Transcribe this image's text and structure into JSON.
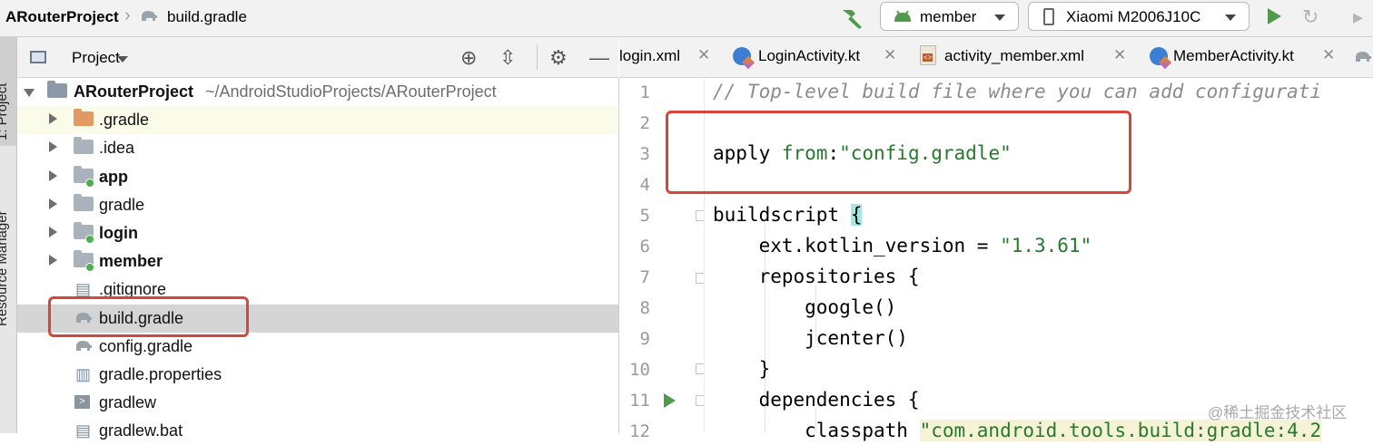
{
  "breadcrumb": {
    "project": "ARouterProject",
    "file": "build.gradle"
  },
  "toolbar": {
    "run_config": "member",
    "device": "Xiaomi M2006J10C"
  },
  "side_strip": {
    "tab_project": "1: Project",
    "tab_resource": "Resource Manager"
  },
  "project_panel": {
    "title": "Project",
    "root_name": "ARouterProject",
    "root_path": "~/AndroidStudioProjects/ARouterProject",
    "items": [
      {
        "label": ".gradle"
      },
      {
        "label": ".idea"
      },
      {
        "label": "app"
      },
      {
        "label": "gradle"
      },
      {
        "label": "login"
      },
      {
        "label": "member"
      },
      {
        "label": ".gitignore"
      },
      {
        "label": "build.gradle"
      },
      {
        "label": "config.gradle"
      },
      {
        "label": "gradle.properties"
      },
      {
        "label": "gradlew"
      },
      {
        "label": "gradlew.bat"
      }
    ]
  },
  "editor_tabs": [
    {
      "label": "login.xml"
    },
    {
      "label": "LoginActivity.kt"
    },
    {
      "label": "activity_member.xml"
    },
    {
      "label": "MemberActivity.kt"
    }
  ],
  "editor": {
    "line_numbers": [
      "1",
      "2",
      "3",
      "4",
      "5",
      "6",
      "7",
      "8",
      "9",
      "10",
      "11",
      "12"
    ],
    "line1": "// Top-level build file where you can add configurati",
    "line3_kw": "apply ",
    "line3_from": "from",
    "line3_colon": ":",
    "line3_str": "\"config.gradle\"",
    "line5_a": "buildscript ",
    "line5_b": "{",
    "line6_a": "    ext.kotlin_version = ",
    "line6_str": "\"1.3.61\"",
    "line7": "    repositories {",
    "line8": "        google()",
    "line9": "        jcenter()",
    "line10": "    }",
    "line11": "    dependencies {",
    "line12_a": "        classpath ",
    "line12_str": "\"com.android.tools.build:gradle:4.2"
  },
  "watermark": "@稀土掘金技术社区",
  "colors": {
    "selection": "#d5d5d5",
    "highlight_row": "#fbfbe9",
    "annotation_red": "#d8453a",
    "string_green": "#257a2b",
    "module_dot": "#4caf50"
  }
}
